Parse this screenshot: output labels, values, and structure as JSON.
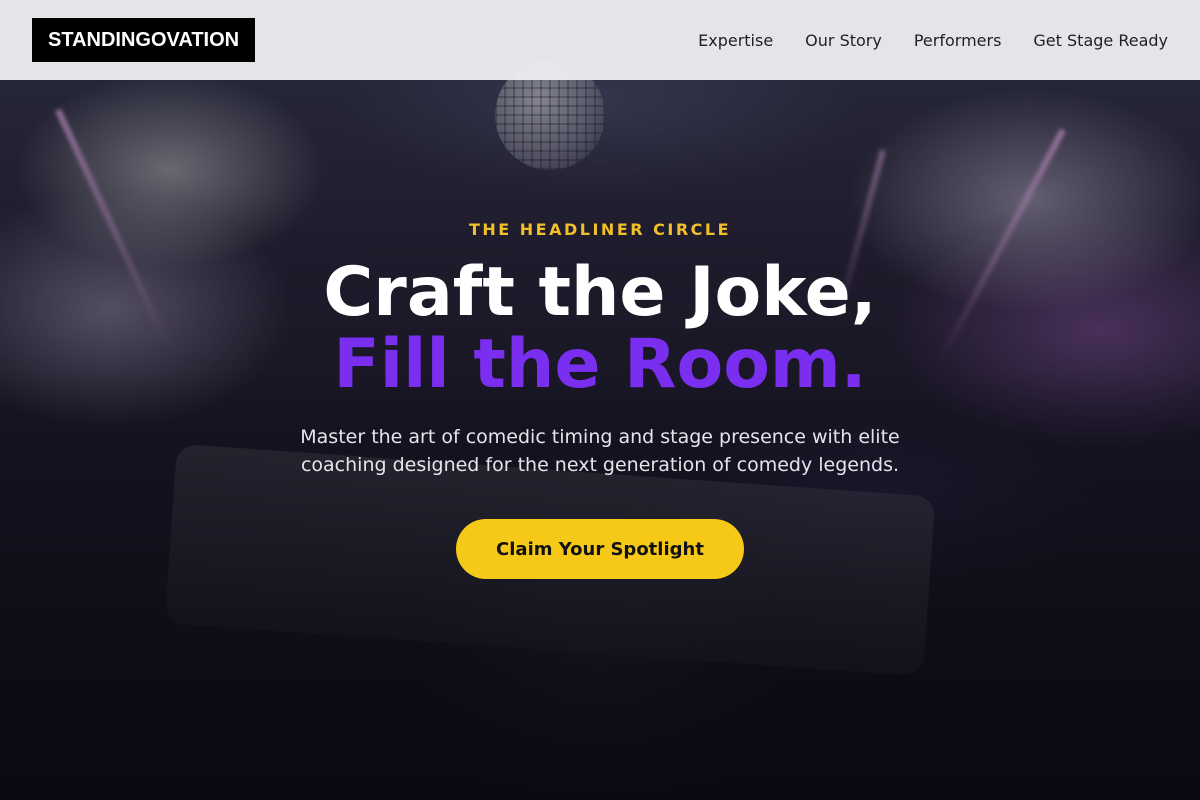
{
  "header": {
    "logo": "STANDINGOVATION",
    "nav": [
      {
        "label": "Expertise"
      },
      {
        "label": "Our Story"
      },
      {
        "label": "Performers"
      },
      {
        "label": "Get Stage Ready"
      }
    ]
  },
  "hero": {
    "eyebrow": "THE HEADLINER CIRCLE",
    "headline_line1": "Craft the Joke,",
    "headline_line2": "Fill the Room.",
    "subtitle": "Master the art of comedic timing and stage presence with elite coaching designed for the next generation of comedy legends.",
    "cta_label": "Claim Your Spotlight"
  },
  "colors": {
    "accent_purple": "#7a2ff0",
    "accent_yellow": "#f6c919",
    "eyebrow_gold": "#f2bf2a"
  }
}
